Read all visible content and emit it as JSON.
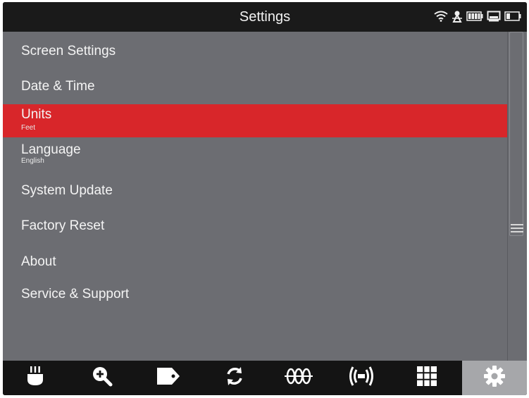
{
  "header": {
    "title": "Settings",
    "status_icons": [
      "wifi-icon",
      "gps-icon",
      "battery-icon",
      "display-icon",
      "battery-low-icon"
    ]
  },
  "menu": {
    "items": [
      {
        "label": "Screen Settings",
        "sub": "",
        "selected": false
      },
      {
        "label": "Date & Time",
        "sub": "",
        "selected": false
      },
      {
        "label": "Units",
        "sub": "Feet",
        "selected": true
      },
      {
        "label": "Language",
        "sub": "English",
        "selected": false
      },
      {
        "label": "System Update",
        "sub": "",
        "selected": false
      },
      {
        "label": "Factory Reset",
        "sub": "",
        "selected": false
      },
      {
        "label": "About",
        "sub": "",
        "selected": false
      },
      {
        "label": "Service & Support",
        "sub": "",
        "selected": false
      }
    ]
  },
  "toolbar": {
    "buttons": [
      {
        "icon": "probe-icon",
        "active": false
      },
      {
        "icon": "zoom-in-icon",
        "active": false
      },
      {
        "icon": "tag-icon",
        "active": false
      },
      {
        "icon": "refresh-icon",
        "active": false
      },
      {
        "icon": "rebar-icon",
        "active": false
      },
      {
        "icon": "signal-icon",
        "active": false
      },
      {
        "icon": "grid-icon",
        "active": false
      },
      {
        "icon": "gear-icon",
        "active": true
      }
    ]
  },
  "colors": {
    "selected": "#d8262a",
    "list_background": "#6c6d72",
    "bar_background": "#1a1a1a",
    "active_tab": "#a6a7aa"
  }
}
